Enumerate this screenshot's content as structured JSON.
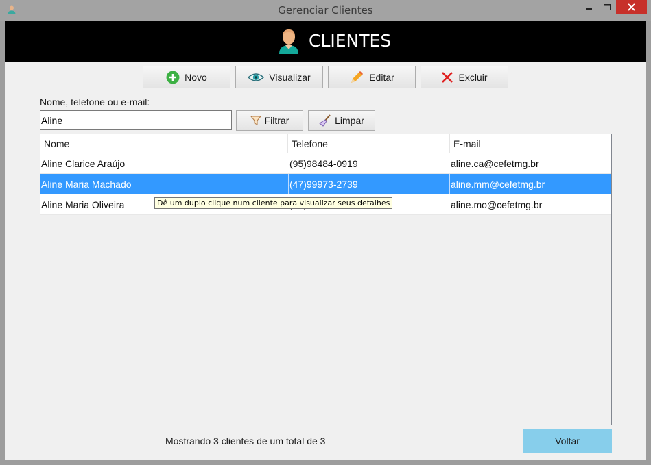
{
  "window": {
    "title": "Gerenciar Clientes"
  },
  "header": {
    "title": "CLIENTES",
    "icon": "person-avatar-icon"
  },
  "toolbar": {
    "new_label": "Novo",
    "view_label": "Visualizar",
    "edit_label": "Editar",
    "delete_label": "Excluir"
  },
  "filter": {
    "label": "Nome, telefone ou e-mail:",
    "value": "Aline",
    "filter_label": "Filtrar",
    "clear_label": "Limpar"
  },
  "table": {
    "columns": [
      "Nome",
      "Telefone",
      "E-mail"
    ],
    "rows": [
      {
        "name": "Aline Clarice Araújo",
        "phone": "(95)98484-0919",
        "email": "aline.ca@cefetmg.br"
      },
      {
        "name": "Aline Maria Machado",
        "phone": "(47)99973-2739",
        "email": "aline.mm@cefetmg.br"
      },
      {
        "name": "Aline Maria Oliveira",
        "phone": "(47)",
        "email": "aline.mo@cefetmg.br"
      }
    ],
    "selected_row": 2
  },
  "tooltip": "Dê um duplo clique num cliente para visualizar seus detalhes",
  "status": "Mostrando 3 clientes de um total de 3",
  "back_label": "Voltar",
  "colors": {
    "selection": "#3399ff",
    "back_button": "#87ceeb",
    "close_button": "#c7302a",
    "header_bg": "#000000"
  }
}
